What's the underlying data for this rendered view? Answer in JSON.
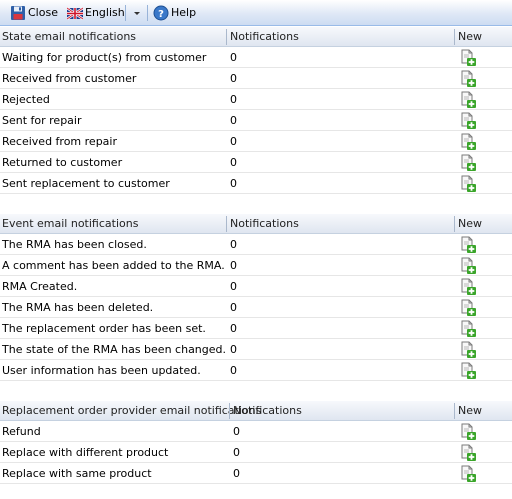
{
  "toolbar": {
    "close_label": "Close",
    "language_label": "English",
    "help_label": "Help"
  },
  "sections": [
    {
      "title": "State email notifications",
      "notifications_header": "Notifications",
      "new_header": "New",
      "rows": [
        {
          "name": "Waiting for product(s) from customer",
          "count": "0"
        },
        {
          "name": "Received from customer",
          "count": "0"
        },
        {
          "name": "Rejected",
          "count": "0"
        },
        {
          "name": "Sent for repair",
          "count": "0"
        },
        {
          "name": "Received from repair",
          "count": "0"
        },
        {
          "name": "Returned to customer",
          "count": "0"
        },
        {
          "name": "Sent replacement to customer",
          "count": "0"
        }
      ]
    },
    {
      "title": "Event email notifications",
      "notifications_header": "Notifications",
      "new_header": "New",
      "rows": [
        {
          "name": "The RMA has been closed.",
          "count": "0"
        },
        {
          "name": "A comment has been added to the RMA.",
          "count": "0"
        },
        {
          "name": "RMA Created.",
          "count": "0"
        },
        {
          "name": "The RMA has been deleted.",
          "count": "0"
        },
        {
          "name": "The replacement order has been set.",
          "count": "0"
        },
        {
          "name": "The state of the RMA has been changed.",
          "count": "0"
        },
        {
          "name": "User information has been updated.",
          "count": "0"
        }
      ]
    },
    {
      "title": "Replacement order provider email notifications",
      "notifications_header": "Notifications",
      "new_header": "New",
      "rows": [
        {
          "name": "Refund",
          "count": "0"
        },
        {
          "name": "Replace with different product",
          "count": "0"
        },
        {
          "name": "Replace with same product",
          "count": "0"
        }
      ]
    }
  ]
}
